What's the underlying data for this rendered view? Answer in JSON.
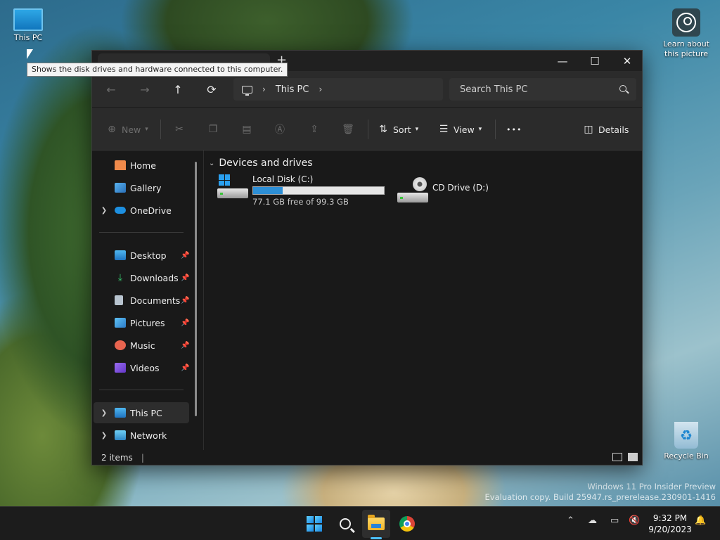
{
  "desktop": {
    "this_pc_label": "This PC",
    "learn_label_line1": "Learn about",
    "learn_label_line2": "this picture",
    "recycle_label": "Recycle Bin",
    "tooltip": "Shows the disk drives and hardware connected to this computer.",
    "watermark_line1": "Windows 11 Pro Insider Preview",
    "watermark_line2": "Evaluation copy. Build 25947.rs_prerelease.230901-1416"
  },
  "window": {
    "new_tab": "+",
    "minimize": "—",
    "maximize": "☐",
    "close": "✕",
    "nav": {
      "back": "←",
      "forward": "→",
      "up": "↑",
      "refresh": "⟳"
    },
    "address": {
      "chevron": "›",
      "location": "This PC"
    },
    "search_placeholder": "Search This PC",
    "commands": {
      "new": "New",
      "sort": "Sort",
      "view": "View",
      "more": "•••",
      "details": "Details"
    },
    "nav_pane": {
      "home": "Home",
      "gallery": "Gallery",
      "onedrive": "OneDrive",
      "desktop": "Desktop",
      "downloads": "Downloads",
      "documents": "Documents",
      "pictures": "Pictures",
      "music": "Music",
      "videos": "Videos",
      "this_pc": "This PC",
      "network": "Network"
    },
    "content": {
      "group_title": "Devices and drives",
      "drives": [
        {
          "name": "Local Disk (C:)",
          "used_fraction": 0.224,
          "free_text": "77.1 GB free of 99.3 GB"
        },
        {
          "name": "CD Drive (D:)"
        }
      ]
    },
    "status": {
      "items": "2 items"
    }
  },
  "taskbar": {
    "time": "9:32 PM",
    "date": "9/20/2023"
  },
  "colors": {
    "accent": "#2d8fd6",
    "window_bg": "#191919",
    "toolbar_bg": "#2b2b2b"
  }
}
